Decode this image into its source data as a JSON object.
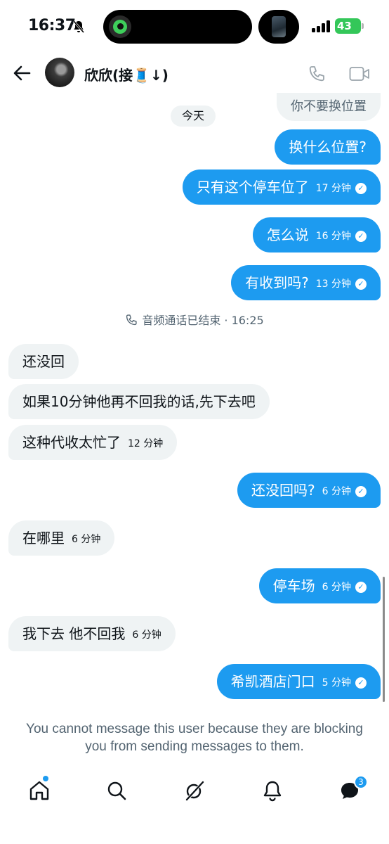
{
  "status_bar": {
    "time": "16:37",
    "battery": "43"
  },
  "header": {
    "contact_name": "欣欣(接🧵↓)"
  },
  "chat": {
    "day_separator": "今天",
    "call_ended": "音频通话已结束 · 16:25",
    "messages": [
      {
        "side": "received",
        "text": "你不要换位置",
        "time": ""
      },
      {
        "side": "sent",
        "text": "换什么位置?",
        "time": ""
      },
      {
        "side": "sent",
        "text": "只有这个停车位了",
        "time": "17 分钟"
      },
      {
        "side": "sent",
        "text": "怎么说",
        "time": "16 分钟"
      },
      {
        "side": "sent",
        "text": "有收到吗?",
        "time": "13 分钟"
      },
      {
        "side": "received",
        "text": "还没回",
        "time": ""
      },
      {
        "side": "received",
        "text": "如果10分钟他再不回我的话,先下去吧",
        "time": ""
      },
      {
        "side": "received",
        "text": "这种代收太忙了",
        "time": "12 分钟"
      },
      {
        "side": "sent",
        "text": "还没回吗?",
        "time": "6 分钟"
      },
      {
        "side": "received",
        "text": "在哪里",
        "time": "6 分钟"
      },
      {
        "side": "sent",
        "text": "停车场",
        "time": "6 分钟"
      },
      {
        "side": "received",
        "text": "我下去 他不回我",
        "time": "6 分钟"
      },
      {
        "side": "sent",
        "text": "希凯酒店门口",
        "time": "5 分钟"
      }
    ]
  },
  "notice": "You cannot message this user because they are blocking you from sending messages to them.",
  "nav": {
    "messages_badge": "3"
  },
  "colors": {
    "accent": "#1d9bf0",
    "received_bubble": "#eff3f4",
    "muted_text": "#536471"
  }
}
